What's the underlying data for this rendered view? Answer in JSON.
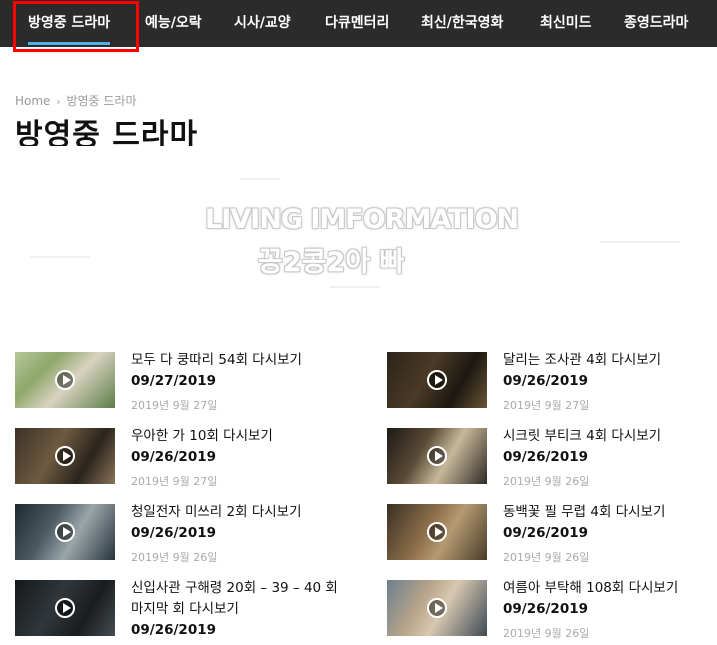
{
  "nav": {
    "items": [
      {
        "label": "방영중 드라마",
        "active": true
      },
      {
        "label": "예능/오락"
      },
      {
        "label": "시사/교양"
      },
      {
        "label": "다큐멘터리"
      },
      {
        "label": "최신/한국영화"
      },
      {
        "label": "최신미드"
      },
      {
        "label": "종영드라마"
      }
    ]
  },
  "breadcrumb": {
    "home": "Home",
    "current": "방영중 드라마"
  },
  "page_title": "방영중 드라마",
  "banner": {
    "line1": "LIVING IMFORMATION",
    "line2": "꽁2콩2아 빠"
  },
  "posts": [
    {
      "title": "모두 다 쿵따리 54회 다시보기",
      "title2": "09/27/2019",
      "date": "2019년 9월 27일"
    },
    {
      "title": "달리는 조사관 4회 다시보기",
      "title2": "09/26/2019",
      "date": "2019년 9월 27일"
    },
    {
      "title": "우아한 가 10회 다시보기",
      "title2": "09/26/2019",
      "date": "2019년 9월 27일"
    },
    {
      "title": "시크릿 부티크 4회 다시보기",
      "title2": "09/26/2019",
      "date": "2019년 9월 26일"
    },
    {
      "title": "청일전자 미쓰리 2회 다시보기",
      "title2": "09/26/2019",
      "date": "2019년 9월 26일"
    },
    {
      "title": "동백꽃 필 무렵 4회 다시보기",
      "title2": "09/26/2019",
      "date": "2019년 9월 26일"
    },
    {
      "title": "신입사관 구해령 20회 – 39 – 40 회 마지막 회 다시보기",
      "title2": "09/26/2019",
      "date": ""
    },
    {
      "title": "여름아 부탁해 108회 다시보기",
      "title2": "09/26/2019",
      "date": "2019년 9월 26일"
    }
  ]
}
